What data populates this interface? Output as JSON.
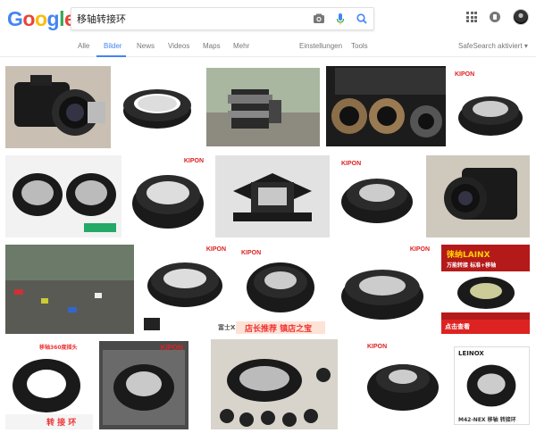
{
  "logo": {
    "letters": [
      "G",
      "o",
      "o",
      "g",
      "l",
      "e"
    ],
    "colors": [
      "#4285f4",
      "#ea4335",
      "#fbbc05",
      "#4285f4",
      "#34a853",
      "#ea4335"
    ]
  },
  "search": {
    "query": "移轴转接环"
  },
  "icons": {
    "camera": "camera-icon",
    "mic": "microphone-icon",
    "search": "search-icon",
    "apps": "apps-icon",
    "notifications": "notifications-icon",
    "account": "account-avatar"
  },
  "tabs": {
    "all": "Alle",
    "images": "Bilder",
    "news": "News",
    "videos": "Videos",
    "maps": "Maps",
    "more": "Mehr",
    "settings": "Einstellungen",
    "tools": "Tools",
    "safesearch": "SafeSearch aktiviert ▾"
  },
  "labels": {
    "kipon": "KIPON",
    "lainx": "徕纳LAINX",
    "lainx_sub": "万能转接 标准+移轴",
    "shop": "店长推荐 镇店之宝",
    "fuji_mark": "富士X",
    "tilt": "移轴360度摇头",
    "adapter": "转 接 环",
    "leinox": "LEINOX",
    "leinox_sub": "M42-NEX 移轴 转接环",
    "hot": "包邮",
    "click": "点击查看"
  },
  "colors": {
    "accent": "#4285f4",
    "brand_red": "#d22222"
  }
}
